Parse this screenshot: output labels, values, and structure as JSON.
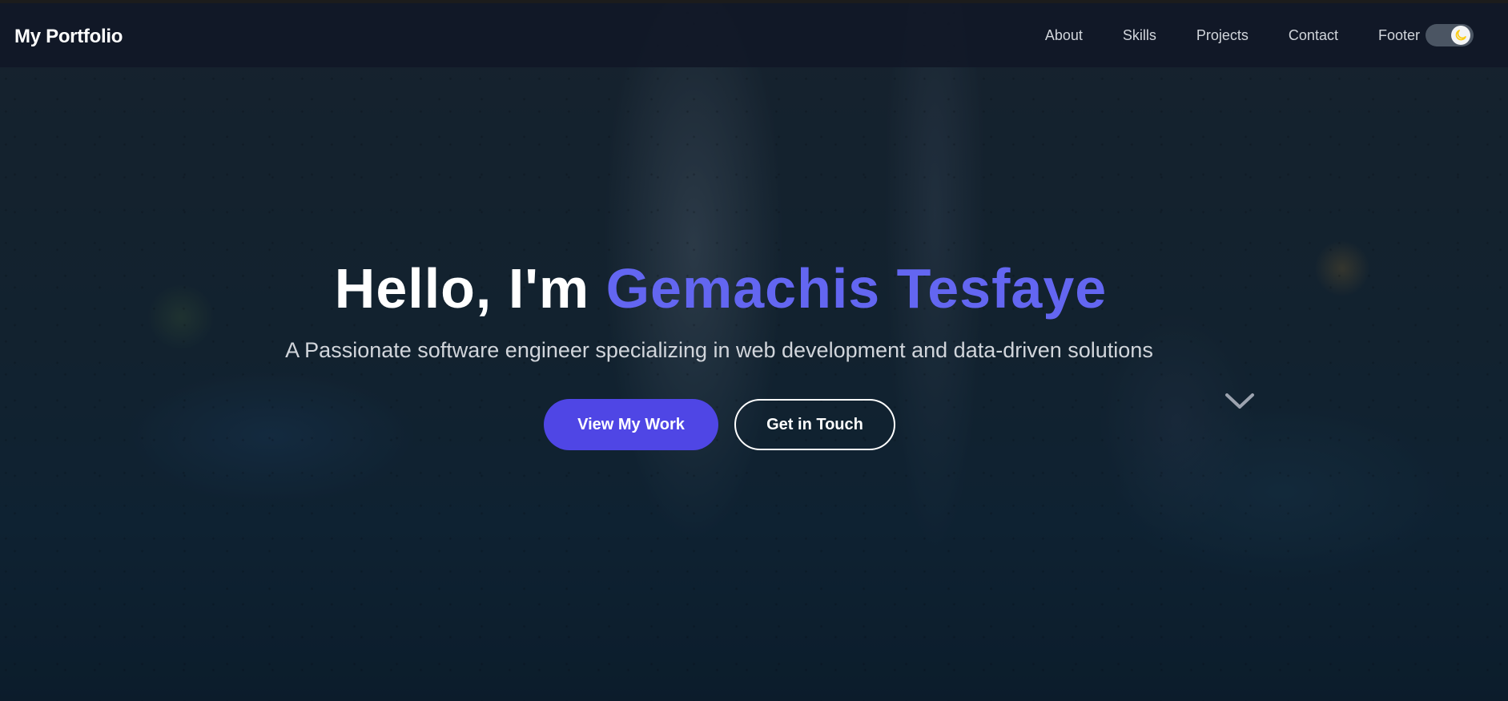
{
  "navbar": {
    "brand": "My Portfolio",
    "links": [
      "About",
      "Skills",
      "Projects",
      "Contact",
      "Footer"
    ],
    "theme_toggle_icon": "moon-icon"
  },
  "hero": {
    "greeting": "Hello, I'm",
    "name": "Gemachis Tesfaye",
    "subtitle": "A Passionate software engineer specializing in web development and data-driven solutions",
    "primary_button": "View My Work",
    "secondary_button": "Get in Touch",
    "scroll_icon": "chevron-down-icon"
  },
  "colors": {
    "accent": "#6366f1",
    "primary_button": "#4f46e5",
    "navbar_bg": "#111827",
    "toggle_moon": "#facc15"
  }
}
